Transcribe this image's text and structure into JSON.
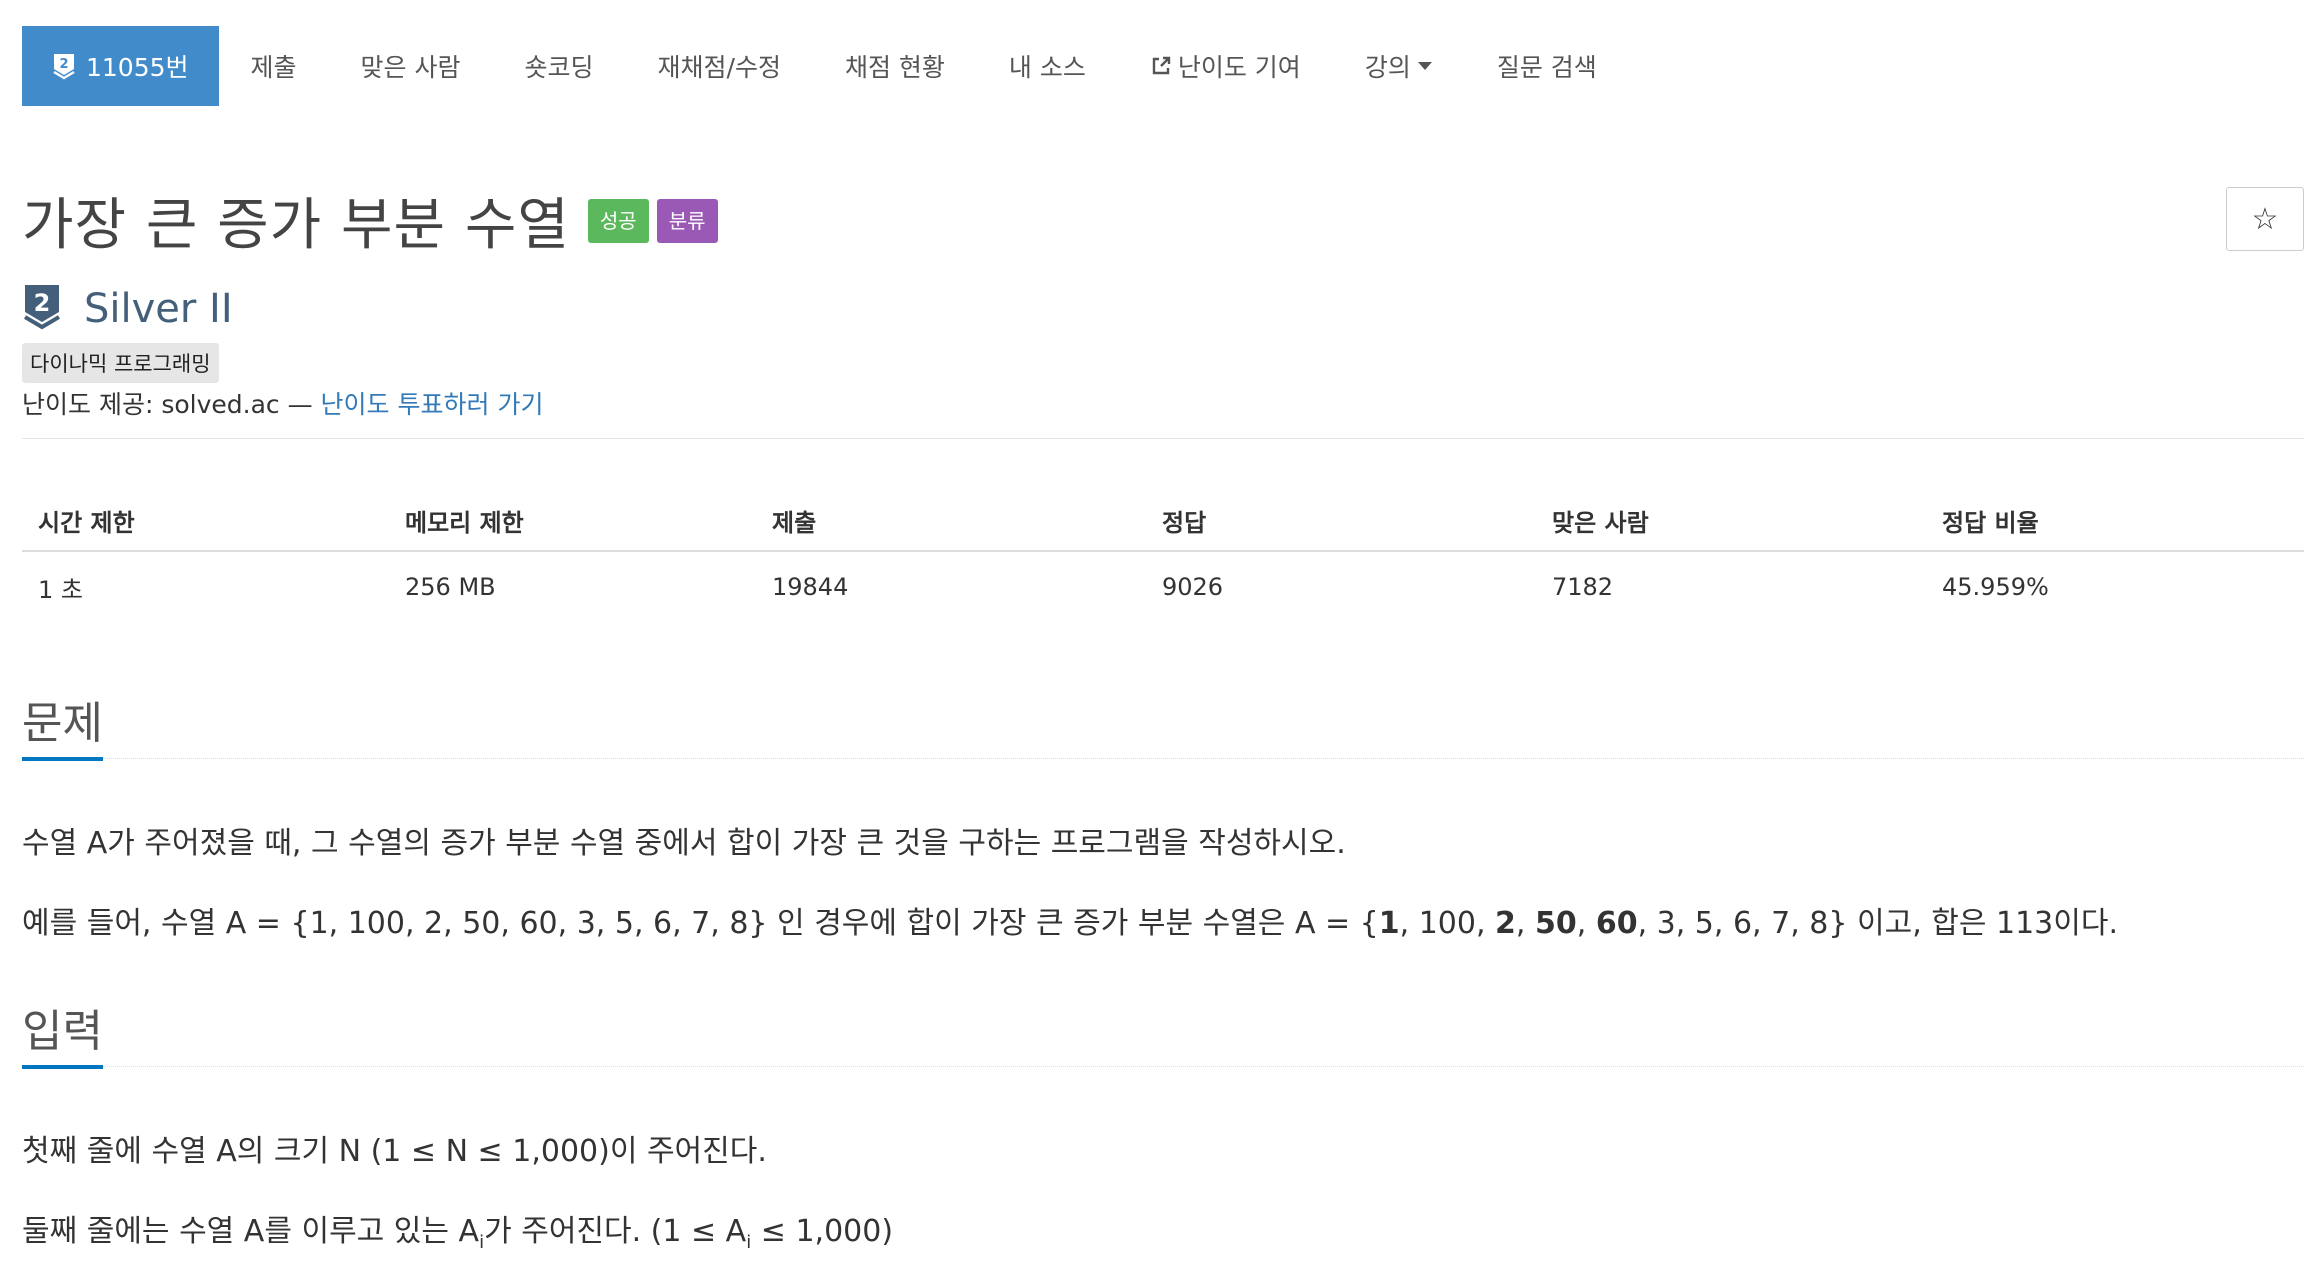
{
  "nav": {
    "problem_tab": "11055번",
    "tier_badge_number": "2",
    "tabs": [
      "제출",
      "맞은 사람",
      "숏코딩",
      "재채점/수정",
      "채점 현황",
      "내 소스",
      "난이도 기여",
      "강의",
      "질문 검색"
    ]
  },
  "problem": {
    "title": "가장 큰 증가 부분 수열",
    "labels": {
      "success": "성공",
      "category": "분류"
    },
    "star": "☆",
    "tier_number": "2",
    "tier_name": "Silver II",
    "tag": "다이나믹 프로그래밍",
    "difficulty_prefix": "난이도 제공: solved.ac — ",
    "difficulty_link": "난이도 투표하러 가기"
  },
  "stats": {
    "headers": [
      "시간 제한",
      "메모리 제한",
      "제출",
      "정답",
      "맞은 사람",
      "정답 비율"
    ],
    "values": [
      "1 초",
      "256 MB",
      "19844",
      "9026",
      "7182",
      "45.959%"
    ]
  },
  "sections": {
    "problem_heading": "문제",
    "problem_p1": "수열 A가 주어졌을 때, 그 수열의 증가 부분 수열 중에서 합이 가장 큰 것을 구하는 프로그램을 작성하시오.",
    "problem_p2": {
      "t1": "예를 들어, 수열 A = {1, 100, 2, 50, 60, 3, 5, 6, 7, 8} 인 경우에 합이 가장 큰 증가 부분 수열은 A = {",
      "b1": "1",
      "t2": ", 100, ",
      "b2": "2",
      "t3": ", ",
      "b3": "50",
      "t4": ", ",
      "b4": "60",
      "t5": ", 3, 5, 6, 7, 8} 이고, 합은 113이다."
    },
    "input_heading": "입력",
    "input_p1": "첫째 줄에 수열 A의 크기 N (1 ≤ N ≤ 1,000)이 주어진다.",
    "input_p2": {
      "t1": "둘째 줄에는 수열 A를 이루고 있는 A",
      "sub1": "i",
      "t2": "가 주어진다. (1 ≤ A",
      "sub2": "i",
      "t3": " ≤ 1,000)"
    }
  }
}
